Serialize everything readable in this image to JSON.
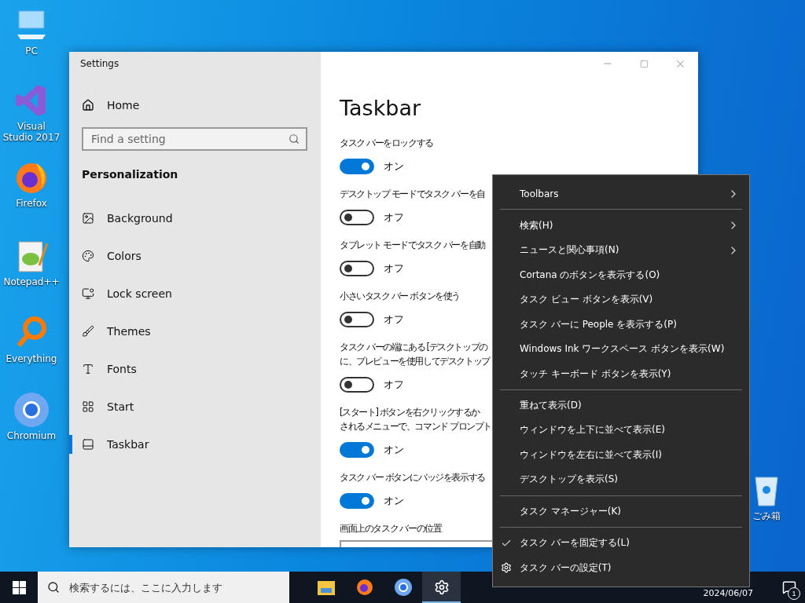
{
  "desktop_icons": [
    {
      "label": "PC"
    },
    {
      "label": "Visual Studio 2017"
    },
    {
      "label": "Firefox"
    },
    {
      "label": "Notepad++"
    },
    {
      "label": "Everything"
    },
    {
      "label": "Chromium"
    },
    {
      "label": "ごみ箱"
    }
  ],
  "window": {
    "title": "Settings"
  },
  "sidebar": {
    "home": "Home",
    "search": {
      "placeholder": "Find a setting"
    },
    "section": "Personalization",
    "items": [
      {
        "label": "Background",
        "selected": false
      },
      {
        "label": "Colors",
        "selected": false
      },
      {
        "label": "Lock screen",
        "selected": false
      },
      {
        "label": "Themes",
        "selected": false
      },
      {
        "label": "Fonts",
        "selected": false
      },
      {
        "label": "Start",
        "selected": false
      },
      {
        "label": "Taskbar",
        "selected": true
      }
    ]
  },
  "content": {
    "title": "Taskbar",
    "settings": [
      {
        "label": [
          "タスク バーをロックする"
        ],
        "on": true,
        "state": "オン"
      },
      {
        "label": [
          "デスクトップ モードでタスク バーを自"
        ],
        "on": false,
        "state": "オフ"
      },
      {
        "label": [
          "タブレット モードでタスク バーを自動"
        ],
        "on": false,
        "state": "オフ"
      },
      {
        "label": [
          "小さいタスク バー ボタンを使う"
        ],
        "on": false,
        "state": "オフ"
      },
      {
        "label": [
          "タスク バーの端にある [デスクトップの",
          "に、プレビューを使用してデスクトップ"
        ],
        "on": false,
        "state": "オフ"
      },
      {
        "label": [
          "[スタート] ボタンを右クリックするか",
          "されるメニューで、コマンド プロンプト"
        ],
        "on": true,
        "state": "オン"
      },
      {
        "label": [
          "タスク バー ボタンにバッジを表示する"
        ],
        "on": true,
        "state": "オン"
      }
    ],
    "position_label": "画面上のタスク バーの位置"
  },
  "context_menu": {
    "groups": [
      [
        {
          "label": "Toolbars",
          "kind": "submenu",
          "checked": false
        }
      ],
      [
        {
          "label": "検索(H)",
          "kind": "submenu",
          "checked": false
        },
        {
          "label": "ニュースと関心事項(N)",
          "kind": "submenu",
          "checked": false
        },
        {
          "label": "Cortana のボタンを表示する(O)",
          "kind": "command",
          "checked": false
        },
        {
          "label": "タスク ビュー ボタンを表示(V)",
          "kind": "command",
          "checked": false
        },
        {
          "label": "タスク バーに People を表示する(P)",
          "kind": "command",
          "checked": false
        },
        {
          "label": "Windows Ink ワークスペース ボタンを表示(W)",
          "kind": "command",
          "checked": false
        },
        {
          "label": "タッチ キーボード ボタンを表示(Y)",
          "kind": "command",
          "checked": false
        }
      ],
      [
        {
          "label": "重ねて表示(D)",
          "kind": "command",
          "checked": false
        },
        {
          "label": "ウィンドウを上下に並べて表示(E)",
          "kind": "command",
          "checked": false
        },
        {
          "label": "ウィンドウを左右に並べて表示(I)",
          "kind": "command",
          "checked": false
        },
        {
          "label": "デスクトップを表示(S)",
          "kind": "command",
          "checked": false
        }
      ],
      [
        {
          "label": "タスク マネージャー(K)",
          "kind": "command",
          "checked": false
        }
      ],
      [
        {
          "label": "タスク バーを固定する(L)",
          "kind": "command",
          "checked": true
        },
        {
          "label": "タスク バーの設定(T)",
          "kind": "settings",
          "checked": false
        }
      ]
    ]
  },
  "taskbar": {
    "search": {
      "placeholder": "検索するには、ここに入力します"
    },
    "apps": [
      {
        "selected": false
      },
      {
        "selected": false
      },
      {
        "selected": false
      },
      {
        "selected": true
      }
    ],
    "date": "2024/06/07",
    "notification_count": "1"
  }
}
